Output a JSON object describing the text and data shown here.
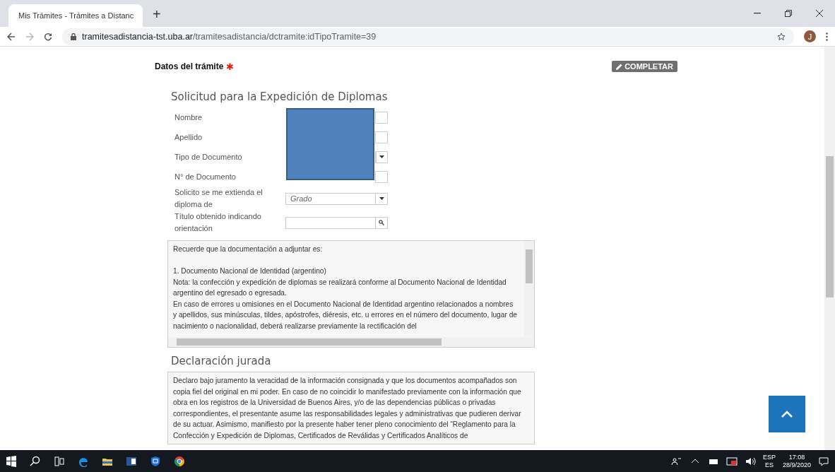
{
  "browser": {
    "tab_title": "Mis Trámites - Trámites a Distanc",
    "new_tab": "+",
    "address_domain": "tramitesadistancia-tst.uba.ar",
    "address_path": "/tramitesadistancia/dctramite:idTipoTramite=39",
    "avatar_letter": "J"
  },
  "section": {
    "title": "Datos del trámite",
    "required_mark": "✱",
    "action": "COMPLETAR"
  },
  "form": {
    "title": "Solicitud para la Expedición de Diplomas",
    "fields": [
      {
        "kind": "text",
        "label": "Nombre",
        "redacted": true
      },
      {
        "kind": "text",
        "label": "Apellido",
        "redacted": true
      },
      {
        "kind": "select",
        "label": "Tipo de Documento",
        "redacted": true
      },
      {
        "kind": "text",
        "label": "N° de Documento",
        "redacted": true
      },
      {
        "kind": "select",
        "label": "Solicito se me extienda el diploma de",
        "value": "Grado",
        "redacted": false
      },
      {
        "kind": "search",
        "label": "Título obtenido indicando orientación",
        "redacted": false
      }
    ],
    "notes": [
      "Recuerde que la documentación a adjuntar es:",
      "1. Documento Nacional de Identidad (argentino)",
      "Nota: la confección y expedición de diplomas se realizará conforme al Documento Nacional de Identidad argentino del egresado o egresada.",
      "En caso de errores u omisiones en el Documento Nacional de Identidad argentino relacionados a nombres y apellidos, sus minúsculas, tildes, apóstrofes, diéresis, etc. u errores en el número del documento, lugar de nacimiento o nacionalidad, deberá realizarse previamente la rectificación del"
    ]
  },
  "declaration": {
    "title": "Declaración jurada",
    "text": "Declaro bajo juramento la veracidad de la información consignada y que los documentos acompañados son copia fiel del original en mi poder. En caso de no coincidir lo manifestado previamente con la información que obra en los registros de la Universidad de Buenos Aires, y/o de las dependencias públicas o privadas correspondientes, el presentante asume las responsabilidades legales y administrativas que pudieren derivar de su actuar. Asimismo, manifiesto por la presente haber tener pleno conocimiento del “Reglamento para la Confección y Expedición de Diplomas, Certificados de Reválidas y Certificados Analíticos de"
  },
  "taskbar": {
    "language_top": "ESP",
    "language_bottom": "ES",
    "time": "17:08",
    "date": "28/9/2020"
  }
}
